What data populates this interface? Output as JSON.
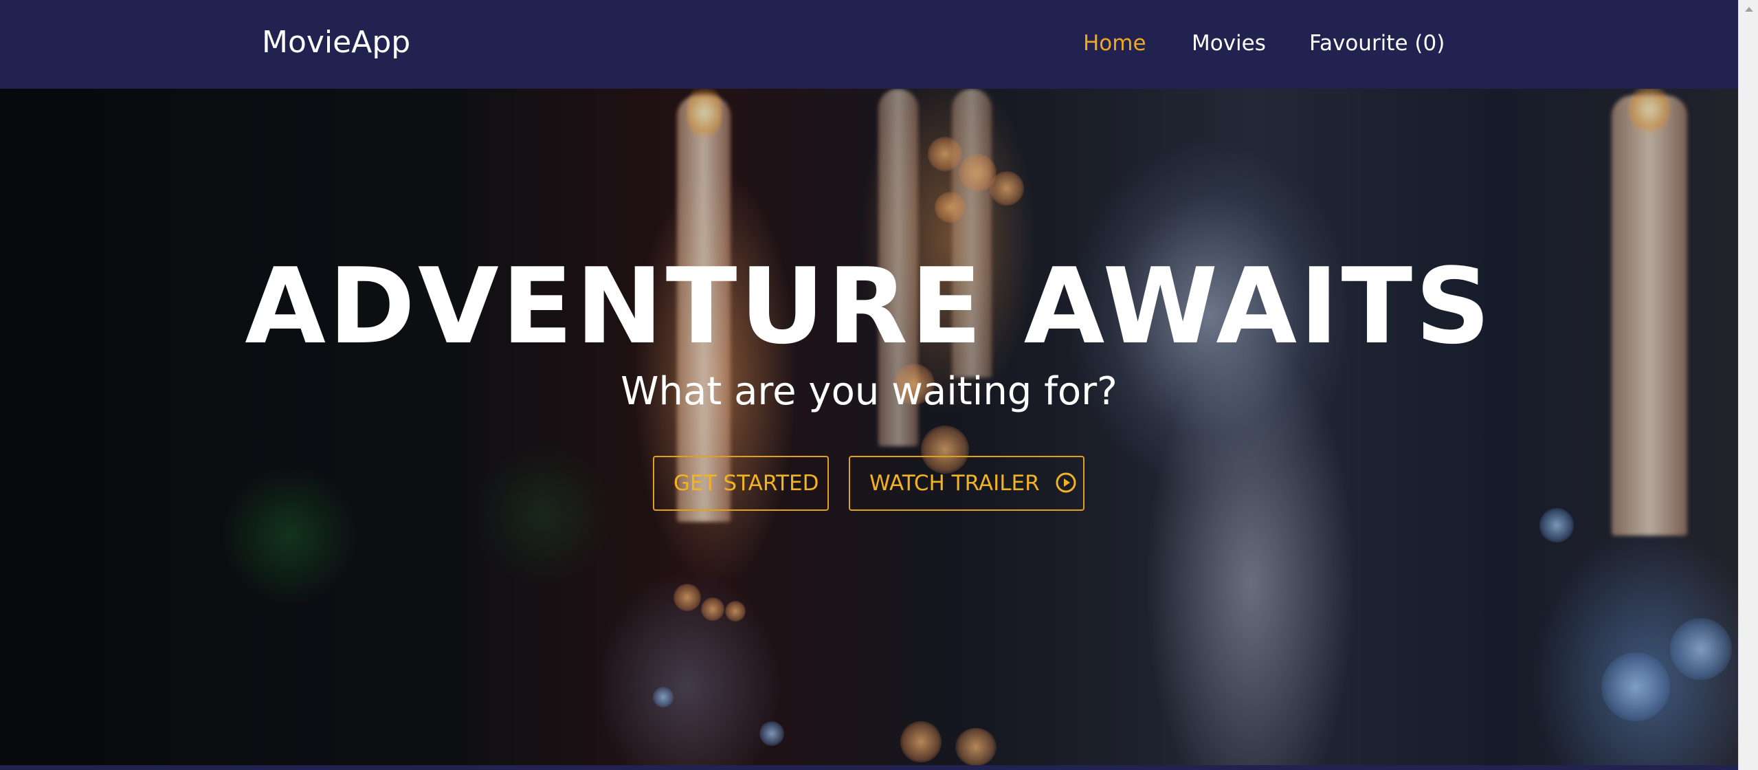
{
  "navbar": {
    "brand": "MovieApp",
    "links": [
      {
        "label": "Home",
        "active": true
      },
      {
        "label": "Movies",
        "active": false
      },
      {
        "label": "Favourite (0)",
        "active": false
      }
    ]
  },
  "hero": {
    "title": "ADVENTURE AWAITS",
    "subtitle": "What are you waiting for?",
    "buttons": {
      "get_started": "GET STARTED",
      "watch_trailer": "WATCH TRAILER",
      "watch_trailer_icon": "play-circle-icon"
    }
  },
  "colors": {
    "navbar_bg": "#21224f",
    "accent": "#f2a81e",
    "text": "#ffffff"
  }
}
